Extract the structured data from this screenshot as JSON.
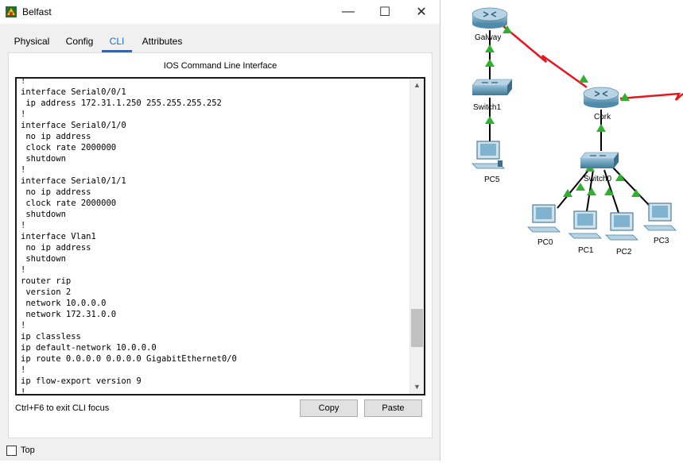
{
  "window": {
    "title": "Belfast",
    "controls": {
      "minimize": "—",
      "maximize": "☐",
      "close": "✕"
    }
  },
  "tabs": [
    {
      "label": "Physical"
    },
    {
      "label": "Config"
    },
    {
      "label": "CLI",
      "selected": true
    },
    {
      "label": "Attributes"
    }
  ],
  "cli": {
    "header": "IOS Command Line Interface",
    "lines": [
      "!",
      "interface Serial0/0/1",
      " ip address 172.31.1.250 255.255.255.252",
      "!",
      "interface Serial0/1/0",
      " no ip address",
      " clock rate 2000000",
      " shutdown",
      "!",
      "interface Serial0/1/1",
      " no ip address",
      " clock rate 2000000",
      " shutdown",
      "!",
      "interface Vlan1",
      " no ip address",
      " shutdown",
      "!",
      "router rip",
      " version 2",
      " network 10.0.0.0",
      " network 172.31.0.0",
      "!",
      "ip classless",
      "ip default-network 10.0.0.0",
      "ip route 0.0.0.0 0.0.0.0 GigabitEthernet0/0",
      "!",
      "ip flow-export version 9",
      "!"
    ],
    "focus_hint": "Ctrl+F6 to exit CLI focus",
    "copy_label": "Copy",
    "paste_label": "Paste"
  },
  "footer": {
    "top_label": "Top",
    "top_checked": false
  },
  "topology": {
    "devices": {
      "galway": "Galway",
      "switch1": "Switch1",
      "pc5": "PC5",
      "cork": "Cork",
      "switch0": "Switch0",
      "pc0": "PC0",
      "pc1": "PC1",
      "pc2": "PC2",
      "pc3": "PC3"
    },
    "colors": {
      "serial_link": "#e8141e",
      "link_up": "#2fb12f",
      "ethernet_link": "#000000"
    }
  }
}
